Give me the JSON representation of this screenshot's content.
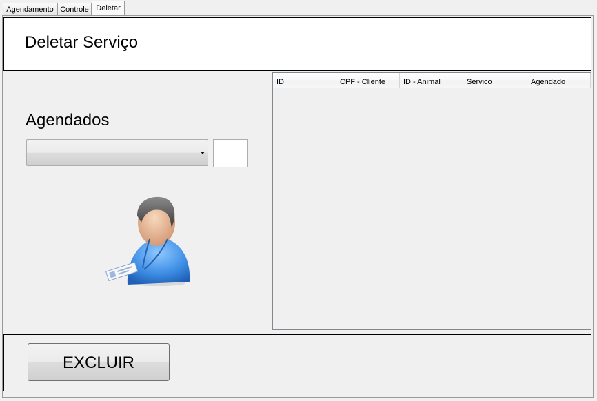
{
  "tabs": [
    {
      "label": "Agendamento",
      "active": false
    },
    {
      "label": "Controle",
      "active": false
    },
    {
      "label": "Deletar",
      "active": true
    }
  ],
  "header": {
    "title": "Deletar Serviço"
  },
  "left": {
    "agendados_label": "Agendados",
    "combo_value": "",
    "small_box_value": "",
    "avatar_icon": "user-with-badge-icon"
  },
  "grid": {
    "columns": [
      "ID",
      "CPF - Cliente",
      "ID - Animal",
      "Servico",
      "Agendado"
    ],
    "rows": []
  },
  "footer": {
    "excluir_label": "EXCLUIR"
  },
  "colors": {
    "background": "#f0f0f0",
    "panel_border": "#000000",
    "grid_border": "#828790"
  }
}
